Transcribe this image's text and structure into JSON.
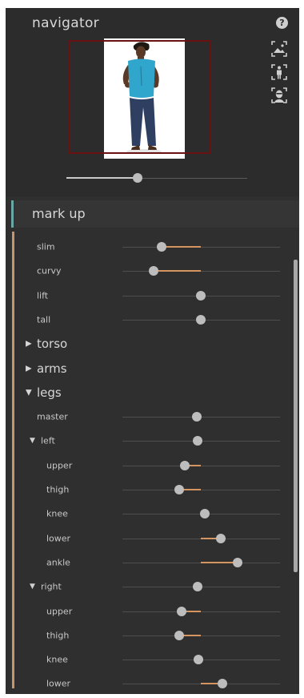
{
  "navigator": {
    "title": "navigator",
    "help": "?",
    "icons": [
      "fit-scene-icon",
      "fit-body-icon",
      "fit-face-icon"
    ],
    "zoom_level_fraction": 0.39
  },
  "markup": {
    "title": "mark up"
  },
  "colors": {
    "accent_teal": "#6aa7a5",
    "accent_orange": "#c8956a",
    "frame_red": "#6a1212"
  },
  "rows": [
    {
      "type": "slider",
      "label": "slim",
      "value": -0.5
    },
    {
      "type": "slider",
      "label": "curvy",
      "value": -0.6
    },
    {
      "type": "slider",
      "label": "lift",
      "value": 0.0
    },
    {
      "type": "slider",
      "label": "tall",
      "value": 0.0
    },
    {
      "type": "section",
      "label": "torso",
      "expanded": false
    },
    {
      "type": "section",
      "label": "arms",
      "expanded": false
    },
    {
      "type": "section",
      "label": "legs",
      "expanded": true
    },
    {
      "type": "slider",
      "label": "master",
      "value": -0.05
    },
    {
      "type": "subsection",
      "label": "left",
      "expanded": true,
      "value": -0.04
    },
    {
      "type": "slider",
      "label": "upper",
      "value": -0.2,
      "indent": true
    },
    {
      "type": "slider",
      "label": "thigh",
      "value": -0.28,
      "indent": true
    },
    {
      "type": "slider",
      "label": "knee",
      "value": 0.05,
      "indent": true
    },
    {
      "type": "slider",
      "label": "lower",
      "value": 0.25,
      "indent": true
    },
    {
      "type": "slider",
      "label": "ankle",
      "value": 0.47,
      "indent": true
    },
    {
      "type": "subsection",
      "label": "right",
      "expanded": true,
      "value": -0.04
    },
    {
      "type": "slider",
      "label": "upper",
      "value": -0.24,
      "indent": true
    },
    {
      "type": "slider",
      "label": "thigh",
      "value": -0.28,
      "indent": true
    },
    {
      "type": "slider",
      "label": "knee",
      "value": -0.03,
      "indent": true
    },
    {
      "type": "slider",
      "label": "lower",
      "value": 0.28,
      "indent": true
    }
  ]
}
